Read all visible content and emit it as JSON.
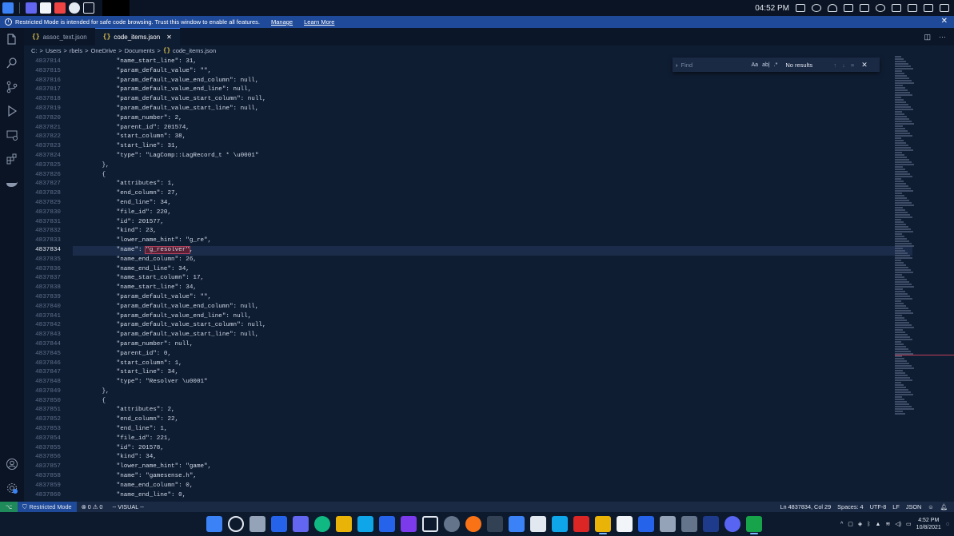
{
  "topbar": {
    "time": "04:52 PM"
  },
  "banner": {
    "message": "Restricted Mode is intended for safe code browsing. Trust this window to enable all features.",
    "manage": "Manage",
    "learn_more": "Learn More",
    "close": "✕"
  },
  "tabs": [
    {
      "label": "assoc_text.json",
      "icon": "{}"
    },
    {
      "label": "code_items.json",
      "icon": "{}",
      "close": "✕"
    }
  ],
  "breadcrumb": [
    "C:",
    "Users",
    "rbels",
    "OneDrive",
    "Documents",
    "code_items.json"
  ],
  "breadcrumb_sep": ">",
  "find": {
    "placeholder": "Find",
    "match_case": "Aa",
    "whole_word": "ab|",
    "regex": ".*",
    "result": "No results",
    "close": "✕"
  },
  "editor": {
    "lines": [
      {
        "n": "4837814",
        "t": "            \"name_start_line\": 31,"
      },
      {
        "n": "4837815",
        "t": "            \"param_default_value\": \"\","
      },
      {
        "n": "4837816",
        "t": "            \"param_default_value_end_column\": null,"
      },
      {
        "n": "4837817",
        "t": "            \"param_default_value_end_line\": null,"
      },
      {
        "n": "4837818",
        "t": "            \"param_default_value_start_column\": null,"
      },
      {
        "n": "4837819",
        "t": "            \"param_default_value_start_line\": null,"
      },
      {
        "n": "4837820",
        "t": "            \"param_number\": 2,"
      },
      {
        "n": "4837821",
        "t": "            \"parent_id\": 201574,"
      },
      {
        "n": "4837822",
        "t": "            \"start_column\": 38,"
      },
      {
        "n": "4837823",
        "t": "            \"start_line\": 31,"
      },
      {
        "n": "4837824",
        "t": "            \"type\": \"LagComp::LagRecord_t * \\u0001\""
      },
      {
        "n": "4837825",
        "t": "        },"
      },
      {
        "n": "4837826",
        "t": "        {"
      },
      {
        "n": "4837827",
        "t": "            \"attributes\": 1,"
      },
      {
        "n": "4837828",
        "t": "            \"end_column\": 27,"
      },
      {
        "n": "4837829",
        "t": "            \"end_line\": 34,"
      },
      {
        "n": "4837830",
        "t": "            \"file_id\": 220,"
      },
      {
        "n": "4837831",
        "t": "            \"id\": 201577,"
      },
      {
        "n": "4837832",
        "t": "            \"kind\": 23,"
      },
      {
        "n": "4837833",
        "t": "            \"lower_name_hint\": \"g_re\","
      },
      {
        "n": "4837834",
        "t": "            \"name\": ",
        "sel": "\"g_resolver\"",
        "after": ",",
        "current": true
      },
      {
        "n": "4837835",
        "t": "            \"name_end_column\": 26,"
      },
      {
        "n": "4837836",
        "t": "            \"name_end_line\": 34,"
      },
      {
        "n": "4837837",
        "t": "            \"name_start_column\": 17,"
      },
      {
        "n": "4837838",
        "t": "            \"name_start_line\": 34,"
      },
      {
        "n": "4837839",
        "t": "            \"param_default_value\": \"\","
      },
      {
        "n": "4837840",
        "t": "            \"param_default_value_end_column\": null,"
      },
      {
        "n": "4837841",
        "t": "            \"param_default_value_end_line\": null,"
      },
      {
        "n": "4837842",
        "t": "            \"param_default_value_start_column\": null,"
      },
      {
        "n": "4837843",
        "t": "            \"param_default_value_start_line\": null,"
      },
      {
        "n": "4837844",
        "t": "            \"param_number\": null,"
      },
      {
        "n": "4837845",
        "t": "            \"parent_id\": 0,"
      },
      {
        "n": "4837846",
        "t": "            \"start_column\": 1,"
      },
      {
        "n": "4837847",
        "t": "            \"start_line\": 34,"
      },
      {
        "n": "4837848",
        "t": "            \"type\": \"Resolver \\u0001\""
      },
      {
        "n": "4837849",
        "t": "        },"
      },
      {
        "n": "4837850",
        "t": "        {"
      },
      {
        "n": "4837851",
        "t": "            \"attributes\": 2,"
      },
      {
        "n": "4837852",
        "t": "            \"end_column\": 22,"
      },
      {
        "n": "4837853",
        "t": "            \"end_line\": 1,"
      },
      {
        "n": "4837854",
        "t": "            \"file_id\": 221,"
      },
      {
        "n": "4837855",
        "t": "            \"id\": 201578,"
      },
      {
        "n": "4837856",
        "t": "            \"kind\": 34,"
      },
      {
        "n": "4837857",
        "t": "            \"lower_name_hint\": \"game\","
      },
      {
        "n": "4837858",
        "t": "            \"name\": \"gamesense.h\","
      },
      {
        "n": "4837859",
        "t": "            \"name_end_column\": 0,"
      },
      {
        "n": "4837860",
        "t": "            \"name_end_line\": 0,"
      }
    ]
  },
  "status": {
    "remote_icon": "⌥",
    "restricted": "Restricted Mode",
    "problems": "⊗ 0 ⚠ 0",
    "mode": "-- VISUAL --",
    "position": "Ln 4837834, Col 29",
    "spaces": "Spaces: 4",
    "encoding": "UTF-8",
    "eol": "LF",
    "language": "JSON"
  },
  "taskbar": {
    "time": "4:52 PM",
    "date": "10/8/2021"
  },
  "colors": {
    "accent": "#1f4a99",
    "editor_bg": "#0f1d33",
    "brace": "#e6c84b",
    "selection": "#5a2036"
  }
}
